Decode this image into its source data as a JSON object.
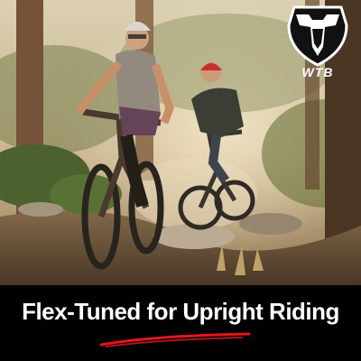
{
  "brand": {
    "logo_text": "WTB",
    "logo_icon": "wtb-logo-icon"
  },
  "headline": "Flex-Tuned for Upright Riding",
  "colors": {
    "caption_background": "#000000",
    "headline_text": "#ffffff",
    "accent_underline": "#e0181f"
  }
}
